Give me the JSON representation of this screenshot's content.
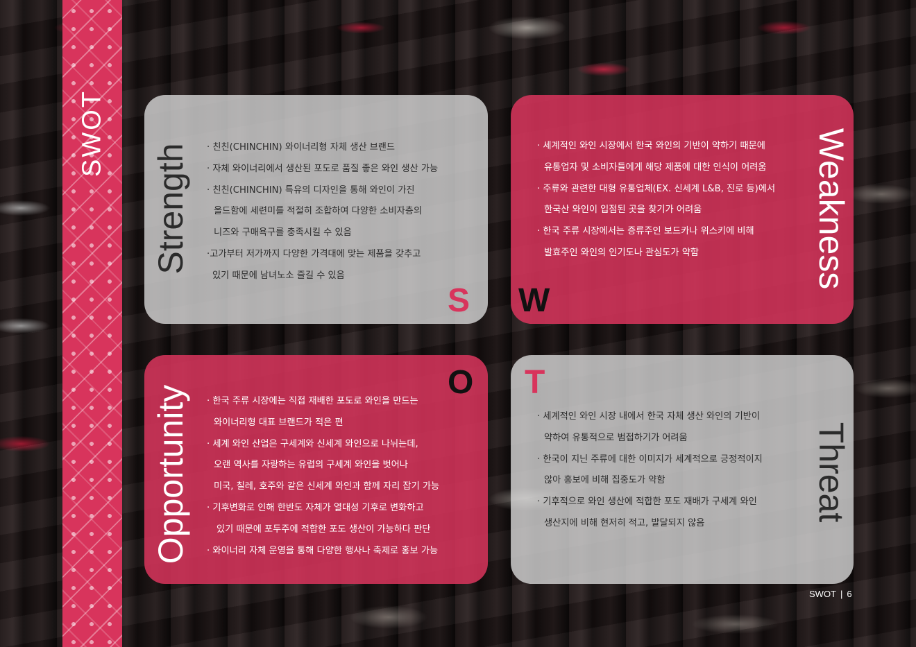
{
  "strip": {
    "title": "SWOT"
  },
  "strength": {
    "title": "Strength",
    "lines": [
      "· 친친(CHINCHIN) 와이너리형 자체 생산 브랜드",
      "· 자체 와이너리에서 생산된 포도로 품질 좋은 와인 생산 가능",
      "· 친친(CHINCHIN) 특유의 디자인을 통해 와인이 가진",
      "올드함에 세련미를 적절히 조합하여 다양한 소비자층의",
      "니즈와 구매욕구를 충족시킬 수 있음",
      "·고가부터 저가까지 다양한 가격대에 맞는 제품을 갖추고",
      "있기 때문에 남녀노소 즐길 수 있음"
    ]
  },
  "weakness": {
    "title": "Weakness",
    "lines": [
      "· 세계적인 와인 시장에서 한국 와인의 기반이 약하기 때문에",
      "유통업자 및 소비자들에게 해당 제품에 대한 인식이 어려움",
      "· 주류와 관련한 대형 유통업체(EX. 신세계 L&B, 진로 등)에서",
      "한국산 와인이 입점된 곳을 찾기가 어려움",
      "· 한국 주류 시장에서는 증류주인 보드카나 위스키에 비해",
      "발효주인 와인의 인기도나 관심도가 약함"
    ]
  },
  "opportunity": {
    "title": "Opportunity",
    "lines": [
      "· 한국 주류 시장에는 직접 재배한 포도로 와인을 만드는",
      "와이너리형 대표 브랜드가 적은 편",
      "· 세계 와인 산업은 구세계와 신세계 와인으로 나뉘는데,",
      "오랜 역사를 자랑하는 유럽의 구세계 와인을 벗어나",
      "미국, 칠레, 호주와 같은 신세계 와인과 함께 자리 잡기 가능",
      "· 기후변화로 인해 한반도 자체가 열대성 기후로 변화하고",
      "있기 때문에 포두주에 적합한 포도 생산이 가능하다 판단",
      "· 와이너리 자체 운영을 통해 다양한 행사나 축제로 홍보 가능"
    ]
  },
  "threat": {
    "title": "Threat",
    "lines": [
      "· 세계적인 와인 시장 내에서 한국 자체 생산 와인의 기반이",
      "약하여 유통적으로 범접하기가 어려움",
      "· 한국이 지닌 주류에 대한 이미지가 세계적으로 긍정적이지",
      "않아 홍보에 비해 집중도가 약함",
      "· 기후적으로 와인 생산에 적합한 포도 재배가 구세계 와인",
      "생산지에 비해 현저히 적고, 발달되지 않음"
    ]
  },
  "letters": {
    "s": "S",
    "w": "W",
    "o": "O",
    "t": "T"
  },
  "footer": {
    "section": "SWOT",
    "separator": "|",
    "page": "6"
  },
  "colors": {
    "accent": "#d8345c",
    "grey_box": "#d7d7d7",
    "dark_text": "#2b2b2b"
  }
}
